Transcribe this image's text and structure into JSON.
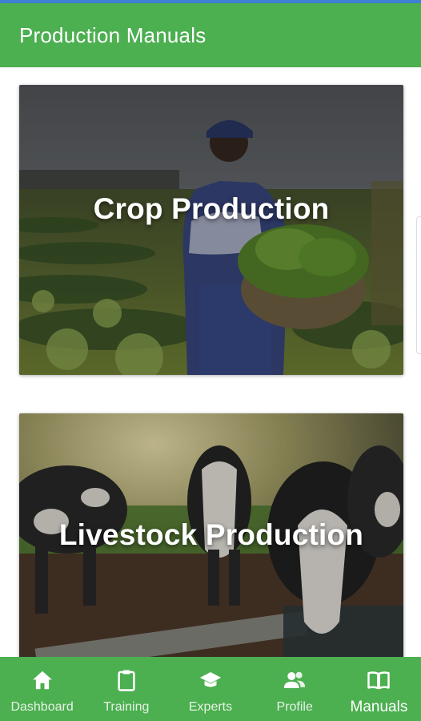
{
  "app": {
    "title": "Production Manuals",
    "colors": {
      "primary": "#4caf50",
      "on_primary": "#ffffff"
    }
  },
  "manuals": [
    {
      "label": "Crop Production",
      "image": "woman-harvesting-vegetables-photo"
    },
    {
      "label": "Livestock Production",
      "image": "cows-drinking-at-trough-photo"
    }
  ],
  "bottom_nav": {
    "active": "Manuals",
    "items": [
      {
        "label": "Dashboard",
        "icon": "home-icon"
      },
      {
        "label": "Training",
        "icon": "clipboard-icon"
      },
      {
        "label": "Experts",
        "icon": "graduation-cap-icon"
      },
      {
        "label": "Profile",
        "icon": "people-icon"
      },
      {
        "label": "Manuals",
        "icon": "open-book-icon"
      }
    ]
  }
}
